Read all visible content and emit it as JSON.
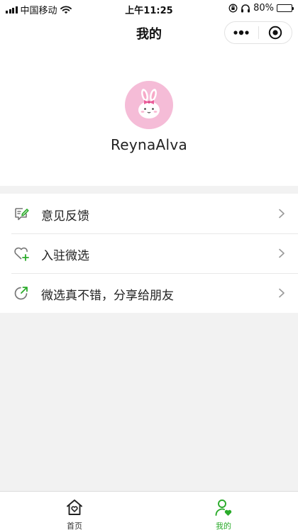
{
  "status_bar": {
    "carrier": "中国移动",
    "time": "上午11:25",
    "battery": "80%",
    "battery_level": 0.8
  },
  "nav": {
    "title": "我的",
    "more_icon": "more-dots-icon",
    "close_icon": "target-circle-icon"
  },
  "profile": {
    "username": "ReynaAlva",
    "avatar_icon": "bunny-avatar"
  },
  "menu": [
    {
      "label": "意见反馈",
      "icon": "feedback-edit-icon"
    },
    {
      "label": "入驻微选",
      "icon": "heart-plus-icon"
    },
    {
      "label": "微选真不错，分享给朋友",
      "icon": "share-arrow-icon"
    }
  ],
  "tabbar": {
    "items": [
      {
        "label": "首页",
        "icon": "home-heart-icon",
        "active": false
      },
      {
        "label": "我的",
        "icon": "user-heart-icon",
        "active": true
      }
    ]
  },
  "colors": {
    "accent": "#2bab2b",
    "avatar_bg": "#f5bcd7",
    "page_bg": "#f2f2f2"
  }
}
